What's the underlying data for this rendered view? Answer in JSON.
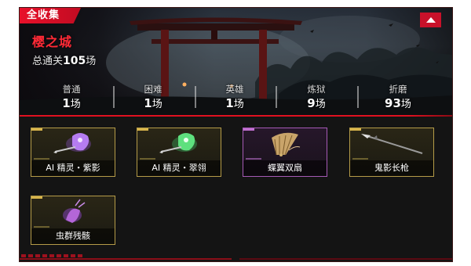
{
  "header": {
    "tag_label": "全收集",
    "map_name": "樱之城",
    "total_prefix": "总通关",
    "total_count": "105",
    "total_suffix": "场"
  },
  "stats": [
    {
      "label": "普通",
      "value": "1",
      "unit": "场"
    },
    {
      "label": "困难",
      "value": "1",
      "unit": "场"
    },
    {
      "label": "英雄",
      "value": "1",
      "unit": "场"
    },
    {
      "label": "炼狱",
      "value": "9",
      "unit": "场"
    },
    {
      "label": "折磨",
      "value": "93",
      "unit": "场"
    }
  ],
  "items": [
    {
      "name": "AI 精灵・紫影",
      "rarity": "gold",
      "icon": "purple-sprite-icon"
    },
    {
      "name": "AI 精灵・翠翎",
      "rarity": "gold",
      "icon": "green-sprite-icon"
    },
    {
      "name": "蝶翼双扇",
      "rarity": "purple",
      "icon": "fan-icon"
    },
    {
      "name": "鬼影长枪",
      "rarity": "gold",
      "icon": "spear-icon"
    },
    {
      "name": "虫群残骸",
      "rarity": "gold",
      "icon": "insect-remains-icon"
    }
  ],
  "colors": {
    "accent_red": "#e8102a",
    "gold_border": "#b59c48",
    "purple_border": "#a65ab6"
  }
}
